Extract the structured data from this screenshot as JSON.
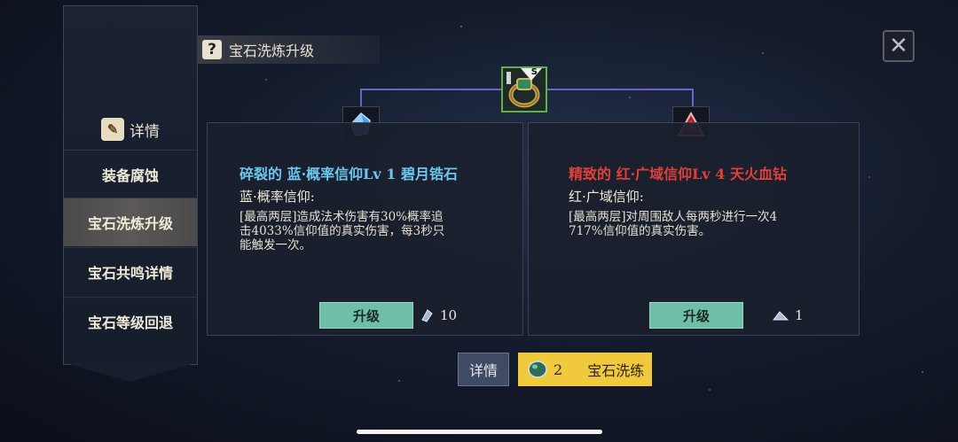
{
  "title": "宝石洗炼升级",
  "sidebar": {
    "header_label": "详情",
    "items": [
      {
        "label": "装备腐蚀",
        "active": false
      },
      {
        "label": "宝石洗炼升级",
        "active": true
      },
      {
        "label": "宝石共鸣详情",
        "active": false
      },
      {
        "label": "宝石等级回退",
        "active": false
      }
    ]
  },
  "center_item": {
    "icon": "emerald-ring-icon",
    "badge": "S"
  },
  "left_card": {
    "gem_icon": "blue-crystal-icon",
    "title": "碎裂的 蓝·概率信仰Lv 1 碧月锆石",
    "title_color": "#6cc7ef",
    "subtitle": "蓝·概率信仰:",
    "desc_lines": [
      "[最高两层]造成法术伤害有30%概率追",
      "击4033%信仰值的真实伤害，每3秒只",
      "能触发一次。"
    ],
    "upgrade_label": "升级",
    "cost_icon": "blue-shard-icon",
    "cost": "10"
  },
  "right_card": {
    "gem_icon": "red-triangle-gem-icon",
    "title": "精致的 红·广域信仰Lv 4 天火血钻",
    "title_color": "#e0403a",
    "subtitle": "红·广域信仰:",
    "desc_lines": [
      "[最高两层]对周围敌人每两秒进行一次4",
      "717%信仰值的真实伤害。"
    ],
    "upgrade_label": "升级",
    "cost_icon": "shard-pile-icon",
    "cost": "1"
  },
  "bottom": {
    "detail_label": "详情",
    "reforge_count": "2",
    "reforge_label": "宝石洗练",
    "reforge_icon": "green-gem-icon"
  },
  "colors": {
    "accent_button": "#6fbfa8",
    "primary_button": "#f1c93d",
    "connector": "#6b63c9"
  }
}
